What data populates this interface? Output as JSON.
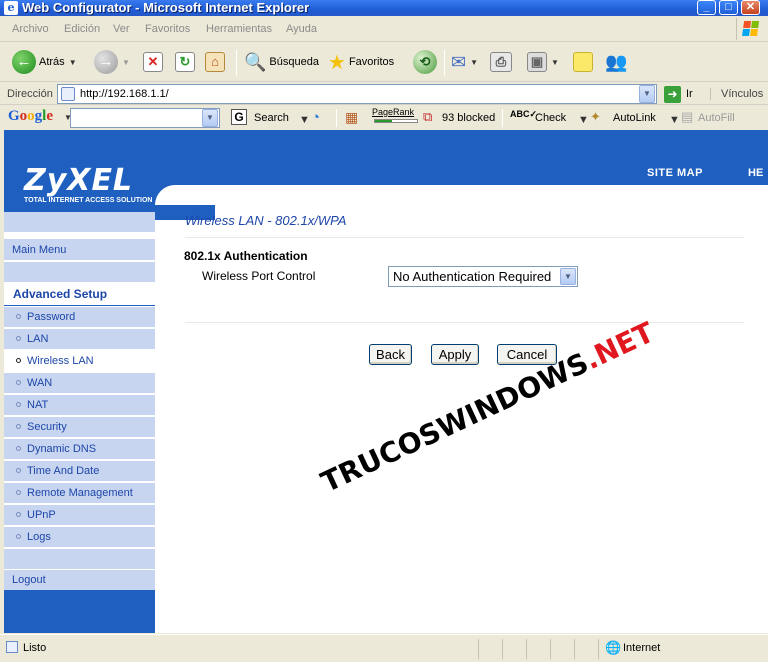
{
  "window": {
    "title": "Web Configurator - Microsoft Internet Explorer",
    "min_label": "_",
    "max_label": "□",
    "close_label": "✕"
  },
  "menu": {
    "items": [
      "Archivo",
      "Edición",
      "Ver",
      "Favoritos",
      "Herramientas",
      "Ayuda"
    ]
  },
  "toolbar": {
    "back_label": "Atrás",
    "search_label": "Búsqueda",
    "favorites_label": "Favoritos"
  },
  "address": {
    "label": "Dirección",
    "url": "http://192.168.1.1/",
    "go_label": "Ir",
    "links_label": "Vínculos"
  },
  "googlebar": {
    "logo": "Google",
    "search_label": "Search",
    "pagerank_label": "PageRank",
    "blocked_label": "93 blocked",
    "check_label": "Check",
    "autolink_label": "AutoLink",
    "autofill_label": "AutoFill"
  },
  "header": {
    "logo": "ZyXEL",
    "tagline": "TOTAL INTERNET ACCESS SOLUTION",
    "sitemap": "SITE MAP",
    "help": "HE"
  },
  "sidebar": {
    "main_menu": "Main Menu",
    "section": "Advanced Setup",
    "items": [
      {
        "label": "Password"
      },
      {
        "label": "LAN"
      },
      {
        "label": "Wireless LAN",
        "active": true
      },
      {
        "label": "WAN"
      },
      {
        "label": "NAT"
      },
      {
        "label": "Security"
      },
      {
        "label": "Dynamic DNS"
      },
      {
        "label": "Time And Date"
      },
      {
        "label": "Remote Management"
      },
      {
        "label": "UPnP"
      },
      {
        "label": "Logs"
      }
    ],
    "logout": "Logout"
  },
  "content": {
    "page_title": "Wireless LAN - 802.1x/WPA",
    "section_title": "802.1x Authentication",
    "field_label": "Wireless Port Control",
    "field_value": "No Authentication Required",
    "buttons": {
      "back": "Back",
      "apply": "Apply",
      "cancel": "Cancel"
    }
  },
  "watermark": {
    "text": "TRUCOSWINDOWS",
    "suffix": ".NET"
  },
  "status": {
    "left": "Listo",
    "zone": "Internet"
  },
  "colors": {
    "brand_blue": "#1f5fbf",
    "sidebar_light": "#c8d5f0",
    "link_blue": "#1c46a8",
    "watermark_red": "#e0171e"
  }
}
